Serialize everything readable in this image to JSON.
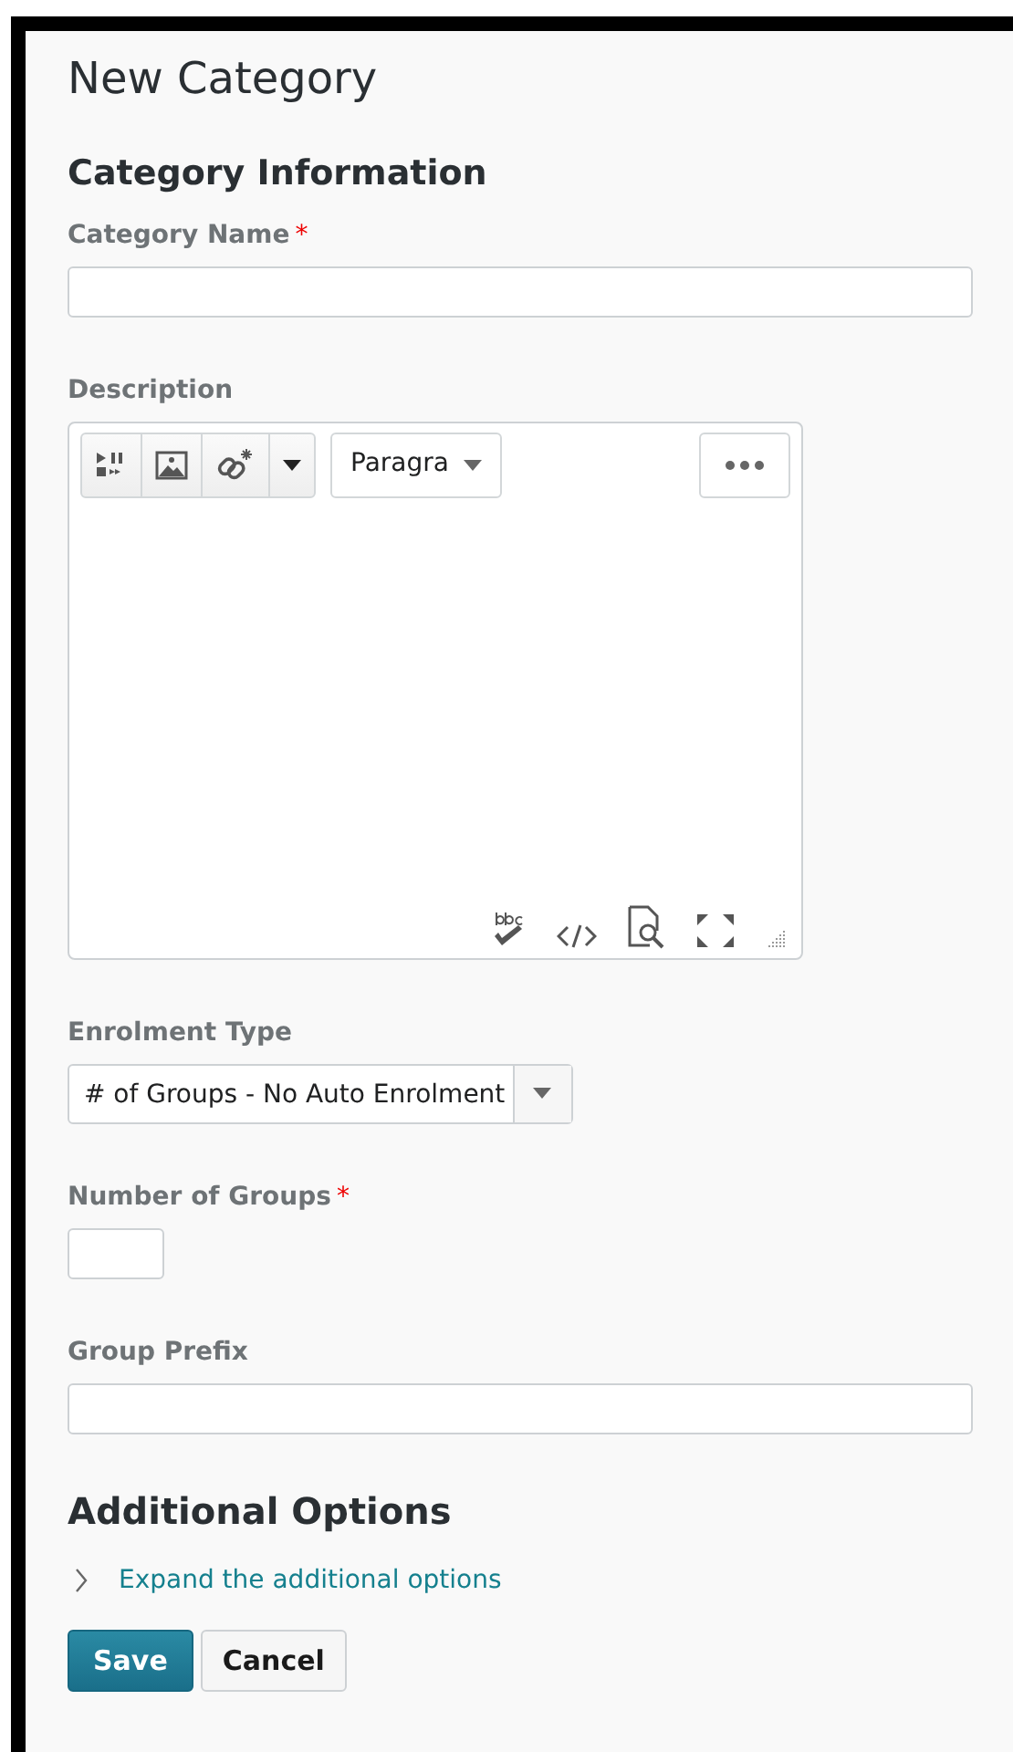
{
  "page_title": "New Category",
  "section": "Category Information",
  "fields": [
    {
      "kind": "text",
      "label": "Category Name",
      "required_mark": "*"
    },
    {
      "kind": "editor",
      "label": "Description",
      "format": "Paragra"
    },
    {
      "kind": "select",
      "label": "Enrolment Type",
      "value": "# of Groups - No Auto Enrolment"
    },
    {
      "kind": "number",
      "label": "Number of Groups",
      "required_mark": "*"
    },
    {
      "kind": "text",
      "label": "Group Prefix"
    }
  ],
  "additional": {
    "heading": "Additional Options",
    "link": "Expand the additional options",
    "expanded": false
  },
  "buttons": [
    {
      "label": "Save",
      "kind": "primary"
    },
    {
      "label": "Cancel",
      "kind": "secondary"
    }
  ]
}
